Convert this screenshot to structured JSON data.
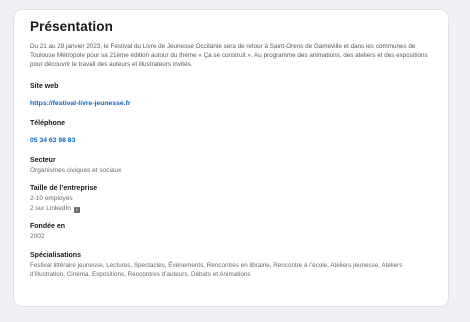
{
  "presentation": {
    "title": "Présentation",
    "description": "Du 21 au 29 janvier 2023, le Festival du Livre de Jeunesse Occitanie sera de retour à Saint-Orens de Gameville et dans les communes de Toulouse Métropole pour sa 21ème édition autour du thème « Ça se construit ». Au programme des animations, des ateliers et des expositions pour découvrir le travail des auteurs et illustrateurs invités."
  },
  "website": {
    "label": "Site web",
    "value": "https://festival-livre-jeunesse.fr"
  },
  "phone": {
    "label": "Téléphone",
    "value": "05 34 63 98 83"
  },
  "sector": {
    "label": "Secteur",
    "value": "Organismes civiques et sociaux"
  },
  "company_size": {
    "label": "Taille de l’entreprise",
    "employees": "2-10 employés",
    "on_linkedin": "2 sur LinkedIn",
    "badge_icon": "linkedin-info-icon"
  },
  "founded": {
    "label": "Fondée en",
    "value": "2002"
  },
  "specialties": {
    "label": "Spécialisations",
    "value": "Festival littéraire jeunesse, Lectures, Spectacles, Évènements, Rencontres en librairie, Rencontre à l’école, Ateliers jeunesse, Ateliers d’illustration, Cinéma, Expositions, Rencontres d’auteurs, Débats et Animations"
  }
}
